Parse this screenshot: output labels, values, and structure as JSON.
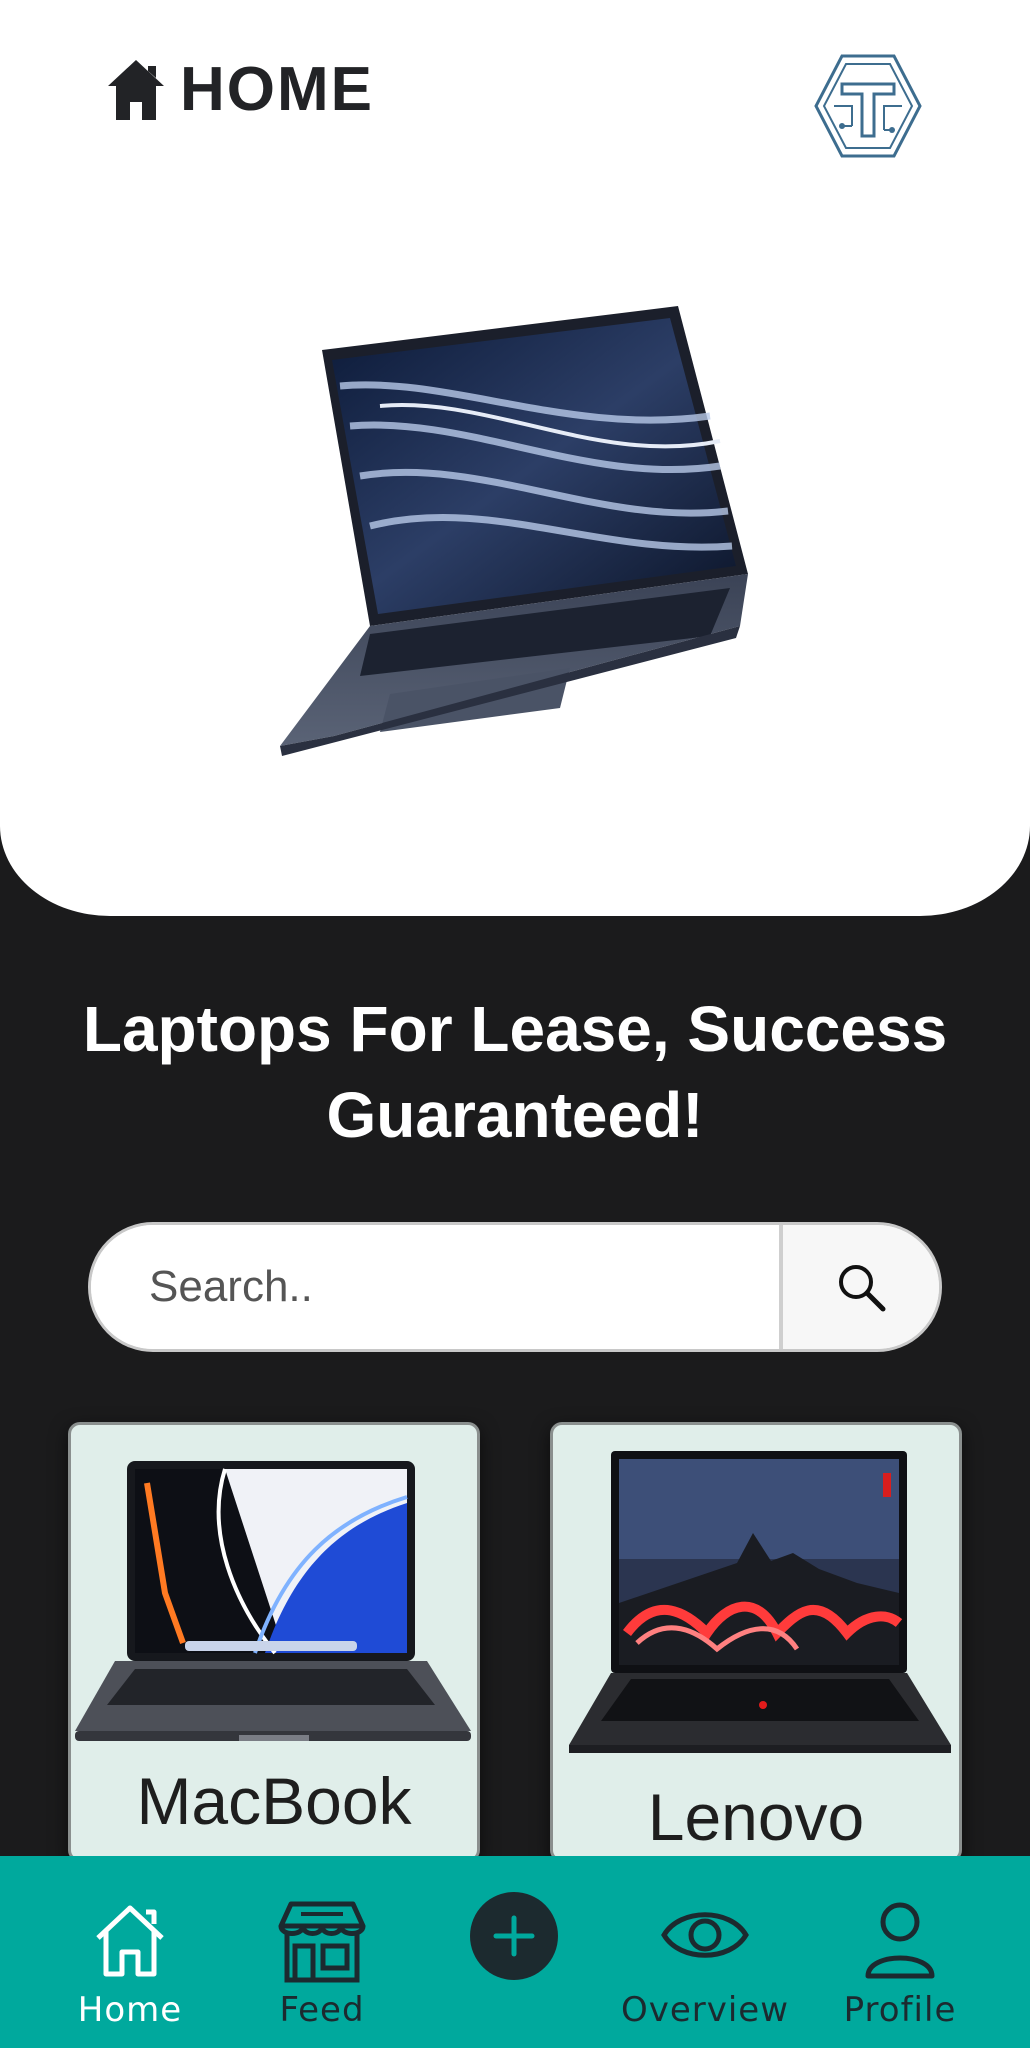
{
  "header": {
    "title": "HOME",
    "logo": "circuit-t-logo"
  },
  "hero": {
    "image": "laptop-product-image"
  },
  "tagline": "Laptops For Lease, Success Guaranteed!",
  "search": {
    "placeholder": "Search..",
    "icon": "search-icon"
  },
  "products": [
    {
      "name": "MacBook"
    },
    {
      "name": "Lenovo"
    }
  ],
  "nav": {
    "items": [
      {
        "label": "Home",
        "icon": "home-icon",
        "active": true
      },
      {
        "label": "Feed",
        "icon": "store-icon",
        "active": false
      },
      {
        "label": "",
        "icon": "plus-icon",
        "active": false
      },
      {
        "label": "Overview",
        "icon": "eye-icon",
        "active": false
      },
      {
        "label": "Profile",
        "icon": "user-icon",
        "active": false
      }
    ]
  },
  "colors": {
    "nav_bg": "#00a99d",
    "page_bg": "#1b1b1c",
    "card_bg": "#e0eeea",
    "accent_dark": "#1c2a2f"
  }
}
